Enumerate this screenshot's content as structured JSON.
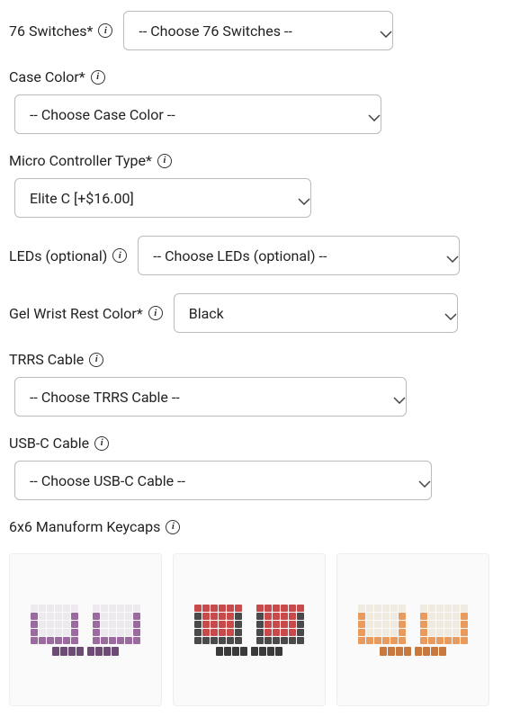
{
  "options": {
    "switches": {
      "label": "76 Switches*",
      "value": "-- Choose 76 Switches --"
    },
    "case_color": {
      "label": "Case Color*",
      "value": "-- Choose Case Color --"
    },
    "micro_controller": {
      "label": "Micro Controller Type*",
      "value": "Elite C [+$16.00]"
    },
    "leds": {
      "label": "LEDs (optional)",
      "value": "-- Choose LEDs (optional) --"
    },
    "wrist_rest": {
      "label": "Gel Wrist Rest Color*",
      "value": "Black"
    },
    "trrs": {
      "label": "TRRS Cable",
      "value": "-- Choose TRRS Cable --"
    },
    "usbc": {
      "label": "USB-C Cable",
      "value": "-- Choose USB-C Cable --"
    },
    "keycaps": {
      "label": "6x6 Manuform Keycaps"
    }
  },
  "keycap_colors": [
    {
      "name": "purple-white",
      "primary": "#eee9ee",
      "secondary": "#9b6a9e",
      "accent": "#6d4b74"
    },
    {
      "name": "red-charcoal",
      "primary": "#c84a4a",
      "secondary": "#4a4a4a",
      "accent": "#3a3a3a"
    },
    {
      "name": "cream-orange",
      "primary": "#f0ebe0",
      "secondary": "#e89b5c",
      "accent": "#c87a3e"
    }
  ]
}
